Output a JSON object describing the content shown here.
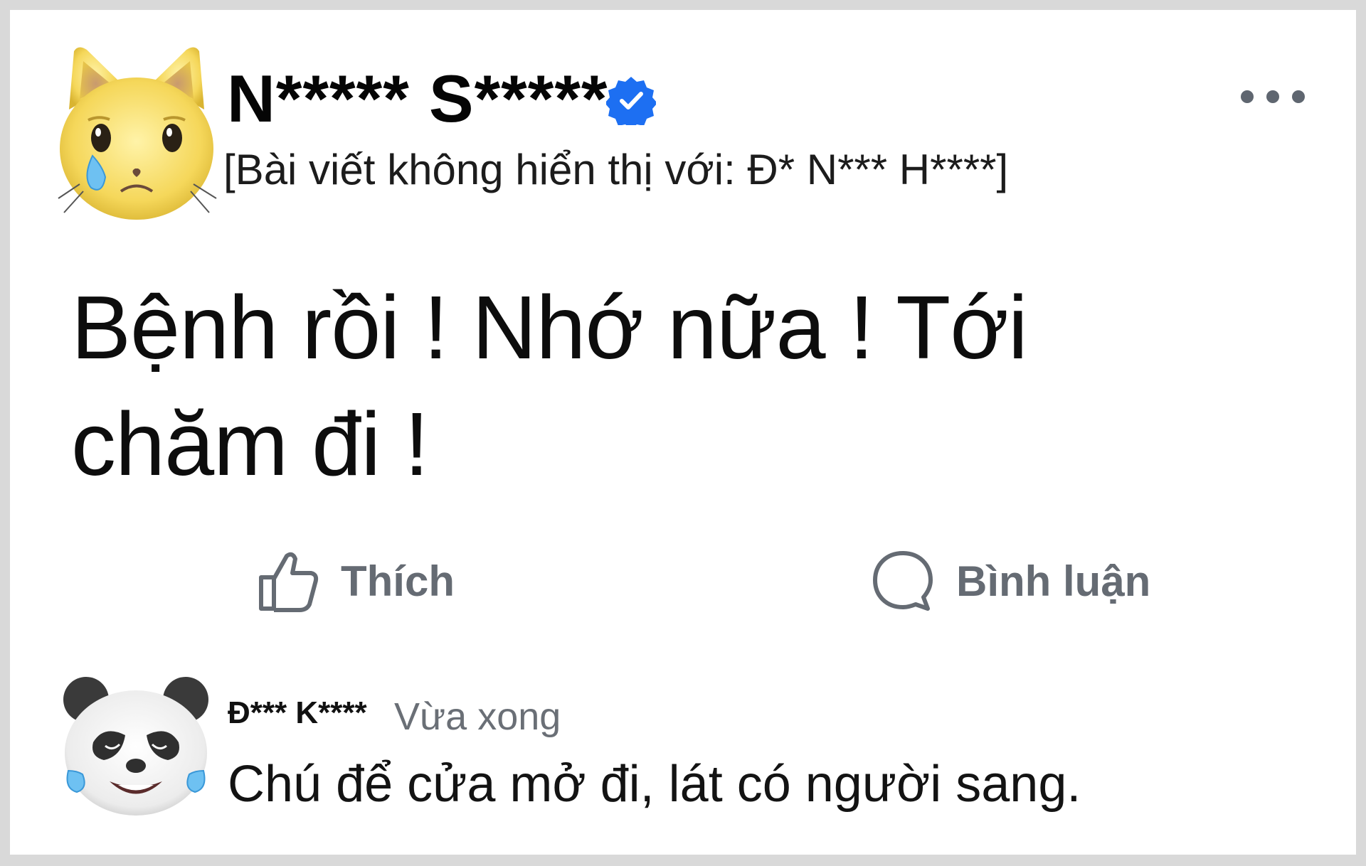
{
  "post": {
    "author_name": "N***** S*****",
    "verified": true,
    "audience_note": "[Bài viết không hiển thị với: Đ* N*** H****]",
    "body_line1": "Bệnh rồi ! Nhớ nữa ! Tới",
    "body_line2": "chăm đi !",
    "actions": {
      "like_label": "Thích",
      "comment_label": "Bình luận"
    },
    "avatar_icon": "crying-cat-memoji-icon",
    "more_icon": "more-options-icon"
  },
  "comment": {
    "author": "Đ*** K****",
    "time": "Vừa xong",
    "text": "Chú để cửa mở đi, lát có người sang.",
    "avatar_icon": "crying-panda-memoji-icon"
  },
  "colors": {
    "page_background": "#d9d9d9",
    "card_background": "#ffffff",
    "verified_blue": "#1d6ff2",
    "action_gray": "#656b73",
    "text_primary": "#050505"
  }
}
